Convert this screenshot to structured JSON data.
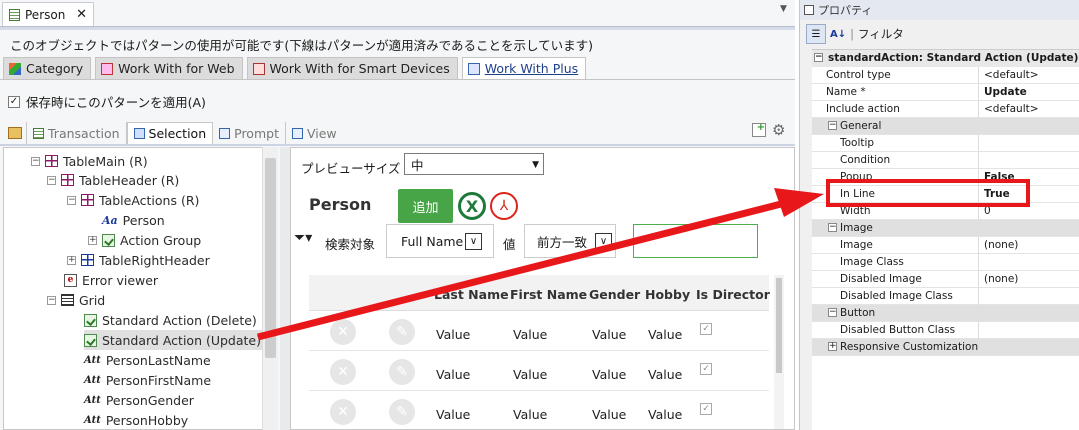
{
  "editor": {
    "tab_label": "Person",
    "description": "このオブジェクトではパターンの使用が可能です(下線はパターンが適用済みであることを示しています)",
    "pattern_tabs": [
      "Category",
      "Work With for Web",
      "Work With for Smart Devices",
      "Work With Plus"
    ],
    "apply_label": "保存時にこのパターンを適用(A)",
    "instance_tabs": [
      "Transaction",
      "Selection",
      "Prompt",
      "View"
    ]
  },
  "tree": {
    "nodes": [
      {
        "label": "TableMain (R)"
      },
      {
        "label": "TableHeader (R)"
      },
      {
        "label": "TableActions (R)"
      },
      {
        "label": "Person"
      },
      {
        "label": "Action Group"
      },
      {
        "label": "TableRightHeader"
      },
      {
        "label": "Error viewer"
      },
      {
        "label": "Grid"
      },
      {
        "label": "Standard Action (Delete)"
      },
      {
        "label": "Standard Action (Update)"
      },
      {
        "label": "PersonLastName"
      },
      {
        "label": "PersonFirstName"
      },
      {
        "label": "PersonGender"
      },
      {
        "label": "PersonHobby"
      }
    ]
  },
  "preview": {
    "size_label": "プレビューサイズ",
    "size_value": "中",
    "title": "Person",
    "add_label": "追加",
    "search_label": "検索対象",
    "field_value": "Full Name",
    "value_label": "値",
    "match_value": "前方一致",
    "columns": [
      "Last Name",
      "First Name",
      "Gender",
      "Hobby",
      "Is Director"
    ],
    "cell_value": "Value",
    "check": "✓"
  },
  "properties": {
    "title": "プロパティ",
    "filter_label": "フィルタ",
    "header": "standardAction: Standard Action (Update)",
    "rows": [
      {
        "name": "Control type",
        "value": "<default>"
      },
      {
        "name": "Name *",
        "value": "Update"
      },
      {
        "name": "Include action",
        "value": "<default>"
      },
      {
        "name": "General",
        "value": ""
      },
      {
        "name": "Tooltip",
        "value": ""
      },
      {
        "name": "Condition",
        "value": ""
      },
      {
        "name": "Popup",
        "value": "False"
      },
      {
        "name": "In Line",
        "value": "True"
      },
      {
        "name": "Width",
        "value": "0"
      },
      {
        "name": "Image",
        "value": ""
      },
      {
        "name": "Image",
        "value": "(none)"
      },
      {
        "name": "Image Class",
        "value": ""
      },
      {
        "name": "Disabled Image",
        "value": "(none)"
      },
      {
        "name": "Disabled Image Class",
        "value": ""
      },
      {
        "name": "Button",
        "value": ""
      },
      {
        "name": "Disabled Button Class",
        "value": ""
      },
      {
        "name": "Responsive Customization",
        "value": ""
      }
    ]
  },
  "colors": {
    "highlight": "#e8171a",
    "add_button": "#47a447"
  }
}
